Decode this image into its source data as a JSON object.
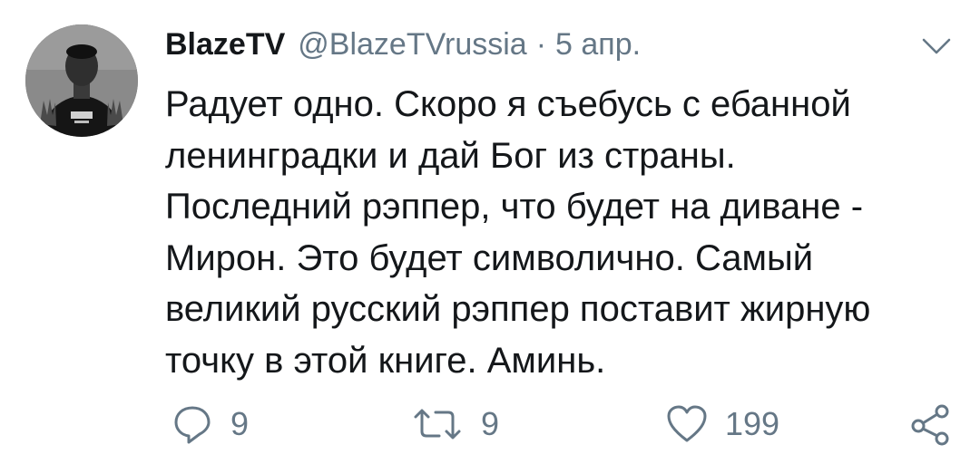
{
  "tweet": {
    "author": {
      "name": "BlazeTV",
      "handle": "@BlazeTVrussia",
      "separator": "·",
      "date": "5 апр."
    },
    "text_lines": [
      "Радует одно. Скоро я съебусь с ебанной",
      "ленинградки и дай Бог из страны.",
      "Последний рэппер, что будет на диване -",
      "Мирон. Это будет символично. Самый",
      "великий русский рэппер поставит жирную",
      "точку в этой книге. Аминь."
    ],
    "actions": {
      "reply_count": "9",
      "retweet_count": "9",
      "like_count": "199"
    },
    "icons": {
      "menu": "chevron-down-icon",
      "reply": "reply-icon",
      "retweet": "retweet-icon",
      "like": "heart-icon",
      "share": "share-icon"
    },
    "colors": {
      "text": "#14171a",
      "secondary": "#657786"
    }
  }
}
